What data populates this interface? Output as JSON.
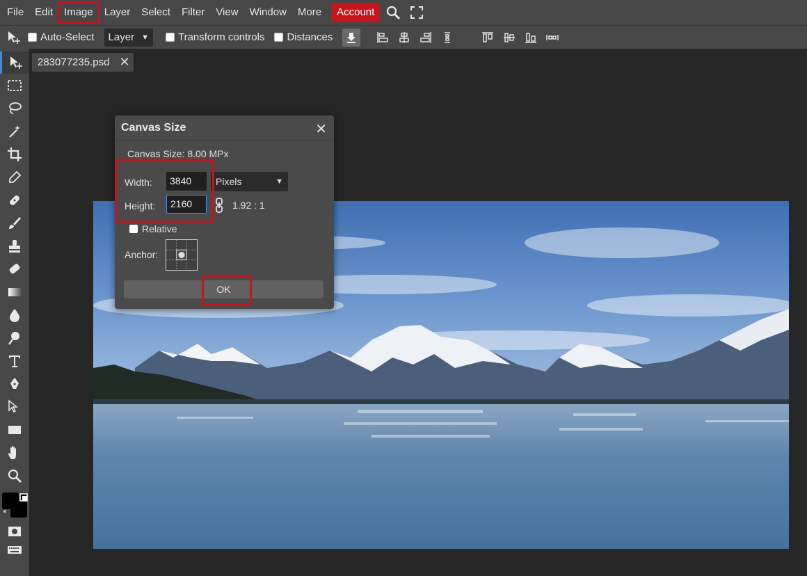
{
  "menu": {
    "items": [
      "File",
      "Edit",
      "Image",
      "Layer",
      "Select",
      "Filter",
      "View",
      "Window",
      "More"
    ],
    "highlighted": "Image",
    "account_label": "Account",
    "icons": [
      "search-icon",
      "fullscreen-icon"
    ]
  },
  "options": {
    "auto_select_label": "Auto-Select",
    "layer_select_value": "Layer",
    "transform_controls_label": "Transform controls",
    "distances_label": "Distances"
  },
  "tab": {
    "filename": "283077235.psd",
    "close_glyph": "✕"
  },
  "dialog": {
    "title": "Canvas Size",
    "close_glyph": "✕",
    "canvas_size_info": "Canvas Size: 8.00 MPx",
    "width_label": "Width:",
    "width_value": "3840",
    "height_label": "Height:",
    "height_value": "2160",
    "unit_value": "Pixels",
    "ratio": "1.92 : 1",
    "relative_label": "Relative",
    "anchor_label": "Anchor:",
    "ok_label": "OK"
  },
  "colors": {
    "accent_red": "#c0161c",
    "account_bg": "#c8141b",
    "active_tool": "#3a8de5"
  }
}
